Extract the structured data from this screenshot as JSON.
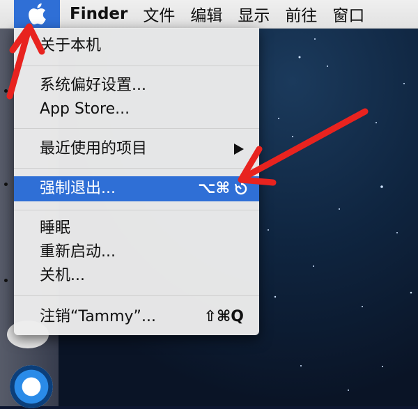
{
  "menubar": {
    "apple_icon": "apple-logo-icon",
    "items": [
      {
        "label": "Finder"
      },
      {
        "label": "文件"
      },
      {
        "label": "编辑"
      },
      {
        "label": "显示"
      },
      {
        "label": "前往"
      },
      {
        "label": "窗口"
      }
    ]
  },
  "apple_menu": {
    "about": "关于本机",
    "system_prefs": "系统偏好设置...",
    "app_store": "App Store...",
    "recent_items": "最近使用的项目",
    "force_quit": "强制退出...",
    "force_quit_shortcut": "⌥⌘",
    "sleep": "睡眠",
    "restart": "重新启动...",
    "shutdown": "关机...",
    "logout": "注销“Tammy”...",
    "logout_shortcut": "⇧⌘Q"
  },
  "colors": {
    "highlight": "#2f6fd6",
    "annotation_arrow": "#e8231f"
  }
}
